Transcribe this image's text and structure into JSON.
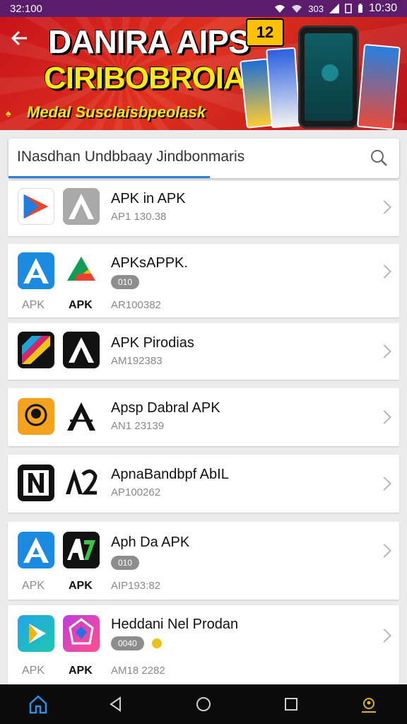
{
  "status_bar": {
    "left": "32:100",
    "signal_text": "303",
    "clock": "10:30"
  },
  "banner": {
    "title": "DANIRA AIPS",
    "subtitle": "CIRIBOBROIAZ",
    "tagline": "Medal Susclaisbpeolask",
    "badge": "12"
  },
  "search": {
    "value": "INasdhan Undbbaay  Jindbonmaris"
  },
  "apps": [
    {
      "title": "APK in APK",
      "meta": "AP1 130.38"
    },
    {
      "title": "APKsAPPK.",
      "pill": "010",
      "meta": "AR100382",
      "cap_left": "APK",
      "cap_right": "APK"
    },
    {
      "title": "APK Pirodias",
      "meta": "AM192383"
    },
    {
      "title": "Apsp Dabral APK",
      "meta": "AN1 23139"
    },
    {
      "title": "ApnaBandbpf AbIL",
      "meta": "AP100262"
    },
    {
      "title": "Aph Da APK",
      "pill": "010",
      "meta": "AIP193:82",
      "cap_left": "APK",
      "cap_right": "APK"
    },
    {
      "title": "Heddani Nel Prodan",
      "pill": "0040",
      "meta": "AM18 2282",
      "cap_left": "APK",
      "cap_right": "APK"
    }
  ],
  "icons": {
    "back": "arrow-left-icon",
    "search": "magnifier-icon",
    "chevron": "chevron-right-icon",
    "nav": [
      "home-icon",
      "back-triangle-icon",
      "home-circle-icon",
      "recents-square-icon",
      "profile-icon"
    ]
  },
  "colors": {
    "status_bar": "#5b1d6b",
    "banner": "#c8141a",
    "accent": "#2f7fd6",
    "banner_text_yellow": "#ffe81a"
  }
}
